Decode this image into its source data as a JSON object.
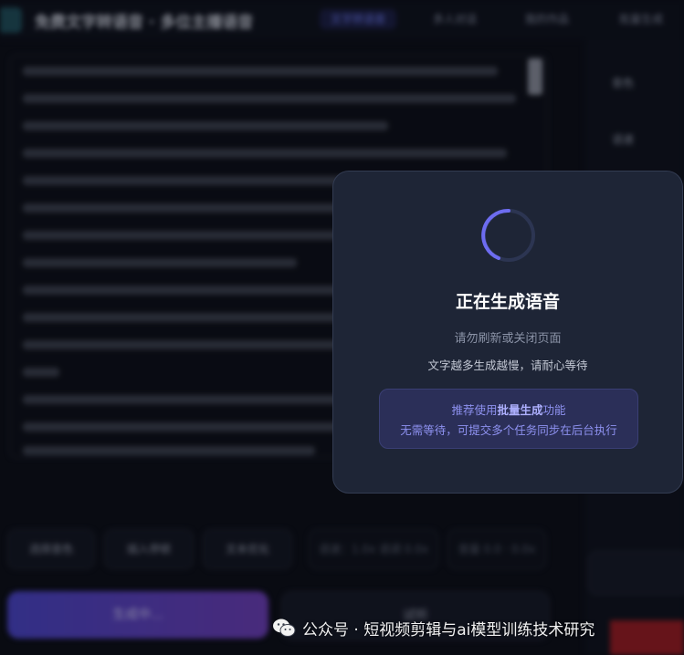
{
  "app": {
    "title": "免费文字转语音 · 多位主播语音",
    "nav": [
      "文字转语音",
      "多人对话",
      "我的作品",
      "批量生成"
    ]
  },
  "side_panel": {
    "items": [
      "音色",
      "语速"
    ]
  },
  "actions": {
    "chips": [
      "选择音色",
      "插入停顿",
      "文本优化",
      "语速：1.0x 语调 0.0x",
      "音量 0.0 · 0.0x"
    ],
    "primary": "生成中...",
    "secondary": "试听"
  },
  "modal": {
    "title": "正在生成语音",
    "subtitle": "请勿刷新或关闭页面",
    "note": "文字越多生成越慢，请耐心等待",
    "tip": {
      "prefix": "推荐使用",
      "highlight": "批量生成",
      "suffix": "功能",
      "line2": "无需等待，可提交多个任务同步在后台执行"
    }
  },
  "watermark": {
    "text": "公众号 · 短视频剪辑与ai模型训练技术研究",
    "icon": "wechat-icon"
  },
  "colors": {
    "accent": "#6f7cf5",
    "modal_bg": "#1e2536",
    "tip_bg": "#2b2f58",
    "tip_text": "#8e91f0"
  }
}
